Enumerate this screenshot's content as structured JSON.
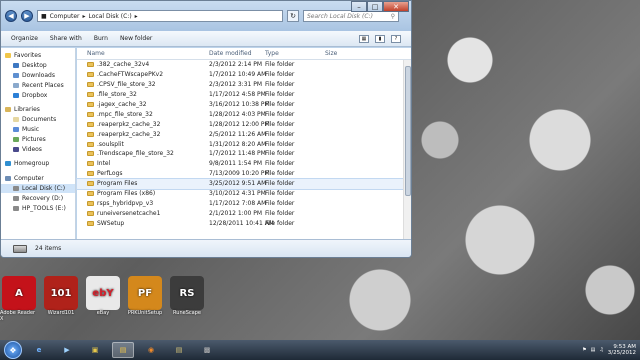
{
  "window": {
    "breadcrumb": [
      "Computer",
      "Local Disk (C:)"
    ],
    "search_placeholder": "Search Local Disk (C:)",
    "toolbar": [
      "Organize",
      "Share with",
      "Burn",
      "New folder"
    ],
    "columns": {
      "name": "Name",
      "date": "Date modified",
      "type": "Type",
      "size": "Size"
    },
    "status": "24 items"
  },
  "navpane": {
    "favorites": {
      "label": "Favorites",
      "items": [
        "Desktop",
        "Downloads",
        "Recent Places",
        "Dropbox"
      ]
    },
    "libraries": {
      "label": "Libraries",
      "items": [
        "Documents",
        "Music",
        "Pictures",
        "Videos"
      ]
    },
    "homegroup": "Homegroup",
    "computer": {
      "label": "Computer",
      "items": [
        "Local Disk (C:)",
        "Recovery (D:)",
        "HP_TOOLS (E:)"
      ]
    }
  },
  "files": [
    {
      "name": ".382_cache_32v4",
      "date": "2/3/2012 2:14 PM",
      "type": "File folder"
    },
    {
      "name": ".CacheFTWscapePKv2",
      "date": "1/7/2012 10:49 AM",
      "type": "File folder"
    },
    {
      "name": ".CPSV_file_store_32",
      "date": "2/3/2012 3:31 PM",
      "type": "File folder"
    },
    {
      "name": ".file_store_32",
      "date": "1/17/2012 4:58 PM",
      "type": "File folder"
    },
    {
      "name": ".jagex_cache_32",
      "date": "3/16/2012 10:38 PM",
      "type": "File folder"
    },
    {
      "name": ".mpc_file_store_32",
      "date": "1/28/2012 4:03 PM",
      "type": "File folder"
    },
    {
      "name": ".reaperpkz_cache_32",
      "date": "1/28/2012 12:00 PM",
      "type": "File folder"
    },
    {
      "name": ".reaperpkz_cache_32",
      "date": "2/5/2012 11:26 AM",
      "type": "File folder"
    },
    {
      "name": ".soulsplit",
      "date": "1/31/2012 8:20 AM",
      "type": "File folder"
    },
    {
      "name": ".Trendscape_file_store_32",
      "date": "1/7/2012 11:48 PM",
      "type": "File folder"
    },
    {
      "name": "Intel",
      "date": "9/8/2011 1:54 PM",
      "type": "File folder"
    },
    {
      "name": "PerfLogs",
      "date": "7/13/2009 10:20 PM",
      "type": "File folder"
    },
    {
      "name": "Program Files",
      "date": "3/25/2012 9:51 AM",
      "type": "File folder"
    },
    {
      "name": "Program Files (x86)",
      "date": "3/10/2012 4:31 PM",
      "type": "File folder"
    },
    {
      "name": "rsps_hybridpvp_v3",
      "date": "1/17/2012 7:08 AM",
      "type": "File folder"
    },
    {
      "name": "runeiversenetcache1",
      "date": "2/1/2012 1:00 PM",
      "type": "File folder"
    },
    {
      "name": "SWSetup",
      "date": "12/28/2011 10:41 AM",
      "type": "File folder"
    }
  ],
  "desktop_icons": [
    {
      "label": "Adobe Reader X",
      "glyph": "A",
      "color": "#c4121a"
    },
    {
      "label": "Wizard101",
      "glyph": "101",
      "color": "#b0221a"
    },
    {
      "label": "eBay",
      "glyph": "ebY",
      "color": "#e9e9e9"
    },
    {
      "label": "PRKUnitSetup",
      "glyph": "PF",
      "color": "#d4881c"
    },
    {
      "label": "RuneScape",
      "glyph": "RS",
      "color": "#3c3c3c"
    }
  ],
  "taskbar": {
    "time": "9:53 AM",
    "date": "3/25/2012"
  }
}
